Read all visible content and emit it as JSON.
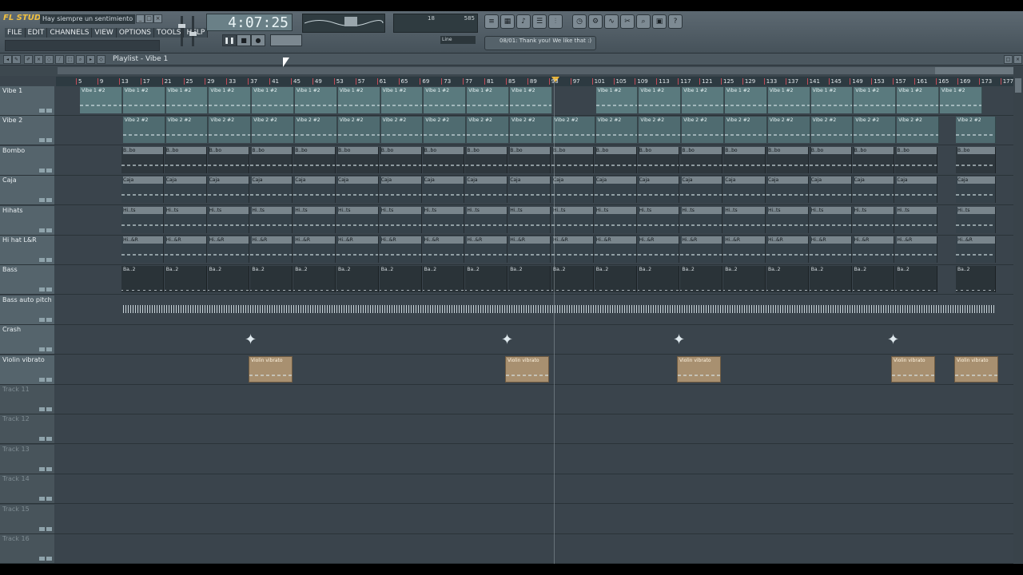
{
  "app": {
    "logo": "FL STUDIO",
    "song_title": "Hay siempre un sentimiento mu..."
  },
  "menu": [
    "FILE",
    "EDIT",
    "CHANNELS",
    "VIEW",
    "OPTIONS",
    "TOOLS",
    "HELP"
  ],
  "time_display": "4:07:25",
  "pattern_display": "",
  "cpu": {
    "value1": "18",
    "value2": "585"
  },
  "snap": "Line",
  "message": "08/01: Thank you! We like that :)",
  "playlist_title": "Playlist - Vibe 1",
  "ruler_ticks": [
    "5",
    "9",
    "13",
    "17",
    "21",
    "25",
    "29",
    "33",
    "37",
    "41",
    "45",
    "49",
    "53",
    "57",
    "61",
    "65",
    "69",
    "73",
    "77",
    "81",
    "85",
    "89",
    "93",
    "97",
    "101",
    "105",
    "109",
    "113",
    "117",
    "121",
    "125",
    "129",
    "133",
    "137",
    "141",
    "145",
    "149",
    "153",
    "157",
    "161",
    "165",
    "169",
    "173",
    "177"
  ],
  "tracks": [
    {
      "name": "Vibe 1",
      "type": "vibe"
    },
    {
      "name": "Vibe 2",
      "type": "vibe2"
    },
    {
      "name": "Bombo",
      "type": "drum"
    },
    {
      "name": "Caja",
      "type": "light"
    },
    {
      "name": "Hihats",
      "type": "light"
    },
    {
      "name": "Hi hat L&R",
      "type": "light"
    },
    {
      "name": "Bass",
      "type": "bass"
    },
    {
      "name": "Bass auto pitch",
      "type": "auto"
    },
    {
      "name": "Crash",
      "type": "crash"
    },
    {
      "name": "Violin vibrato",
      "type": "violin"
    },
    {
      "name": "Track 11",
      "type": "empty"
    },
    {
      "name": "Track 12",
      "type": "empty"
    },
    {
      "name": "Track 13",
      "type": "empty"
    },
    {
      "name": "Track 14",
      "type": "empty"
    },
    {
      "name": "Track 15",
      "type": "empty"
    },
    {
      "name": "Track 16",
      "type": "empty"
    }
  ],
  "clip_labels": {
    "vibe": "Vibe 1 #2",
    "vibe2": "Vibe 2 #2",
    "drum": "B..bo",
    "caja": "Caja",
    "hihats": "Hi..ts",
    "hihatlr": "Hi..&R",
    "bass": "Ba..2",
    "violin": "Violin vibrato"
  }
}
